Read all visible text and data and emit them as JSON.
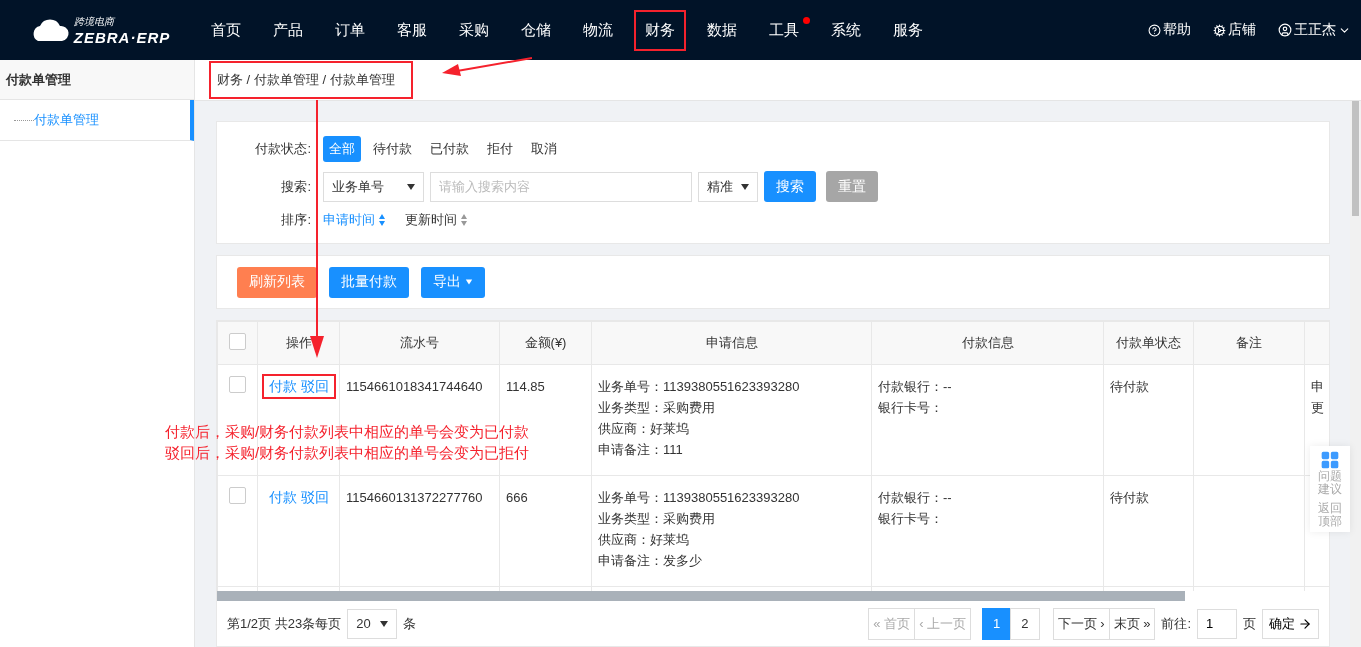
{
  "logo": {
    "tagline": "跨境电商",
    "name": "ZEBRA·ERP"
  },
  "nav": [
    {
      "label": "首页",
      "boxed": false,
      "dot": false
    },
    {
      "label": "产品",
      "boxed": false,
      "dot": false
    },
    {
      "label": "订单",
      "boxed": false,
      "dot": false
    },
    {
      "label": "客服",
      "boxed": false,
      "dot": false
    },
    {
      "label": "采购",
      "boxed": false,
      "dot": false
    },
    {
      "label": "仓储",
      "boxed": false,
      "dot": false
    },
    {
      "label": "物流",
      "boxed": false,
      "dot": false
    },
    {
      "label": "财务",
      "boxed": true,
      "dot": false
    },
    {
      "label": "数据",
      "boxed": false,
      "dot": false
    },
    {
      "label": "工具",
      "boxed": false,
      "dot": true
    },
    {
      "label": "系统",
      "boxed": false,
      "dot": false
    },
    {
      "label": "服务",
      "boxed": false,
      "dot": false
    }
  ],
  "user_menu": [
    {
      "kind": "help",
      "label": "帮助"
    },
    {
      "kind": "store",
      "label": "店铺"
    },
    {
      "kind": "user",
      "label": "王正杰"
    }
  ],
  "sidebar": {
    "title": "付款单管理",
    "items": [
      {
        "label": "付款单管理",
        "selected": true
      }
    ]
  },
  "breadcrumb": {
    "text": "财务 / 付款单管理 / 付款单管理",
    "boxed": true
  },
  "filters": {
    "status": {
      "label": "付款状态:",
      "options": [
        {
          "label": "全部",
          "selected": true
        },
        {
          "label": "待付款",
          "selected": false
        },
        {
          "label": "已付款",
          "selected": false
        },
        {
          "label": "拒付",
          "selected": false
        },
        {
          "label": "取消",
          "selected": false
        }
      ]
    },
    "search": {
      "label": "搜索:",
      "field_type": "业务单号",
      "placeholder": "请输入搜索内容",
      "match": "精准",
      "search_button": "搜索",
      "reset_button": "重置"
    },
    "sort": {
      "label": "排序:",
      "options": [
        {
          "label": "申请时间",
          "selected": true
        },
        {
          "label": "更新时间",
          "selected": false
        }
      ]
    }
  },
  "toolbar": [
    {
      "kind": "refresh",
      "label": "刷新列表"
    },
    {
      "kind": "primary",
      "label": "批量付款"
    },
    {
      "kind": "dropdown",
      "label": "导出"
    }
  ],
  "table": {
    "header_checked": false,
    "columns": [
      "操作",
      "流水号",
      "金额(¥)",
      "申请信息",
      "付款信息",
      "付款单状态",
      "备注"
    ],
    "rows": [
      {
        "checked": false,
        "actions_boxed": true,
        "actions": [
          "付款",
          "驳回"
        ],
        "serial": "1154661018341744640",
        "amount": "114.85",
        "apply_info": [
          "业务单号：1139380551623393280",
          "业务类型：采购费用",
          "供应商：好莱坞",
          "申请备注：111"
        ],
        "pay_info": [
          "付款银行：--",
          "银行卡号："
        ],
        "status": "待付款",
        "column_9": [
          "申",
          "更"
        ]
      },
      {
        "checked": false,
        "actions_boxed": false,
        "actions": [
          "付款",
          "驳回"
        ],
        "serial": "1154660131372277760",
        "amount": "666",
        "apply_info": [
          "业务单号：1139380551623393280",
          "业务类型：采购费用",
          "供应商：好莱坞",
          "申请备注：发多少"
        ],
        "pay_info": [
          "付款银行：--",
          "银行卡号："
        ],
        "status": "待付款"
      }
    ]
  },
  "annotation": [
    "付款后，采购/财务付款列表中相应的单号会变为已付款",
    "驳回后，采购/财务付款列表中相应的单号会变为已拒付"
  ],
  "pagination": {
    "summary": "第1/2页 共23条每页",
    "page_size": "20",
    "unit": "条",
    "nav_before": [
      {
        "label": "« 首页",
        "disabled": true
      },
      {
        "label": "‹ 上一页",
        "disabled": true
      }
    ],
    "pages": [
      {
        "label": "1",
        "selected": true
      },
      {
        "label": "2",
        "selected": false
      }
    ],
    "nav_after": [
      {
        "label": "下一页 ›",
        "disabled": false
      },
      {
        "label": "末页 »",
        "disabled": false
      }
    ],
    "goto_label": "前往:",
    "goto_value": "1",
    "page_unit": "页",
    "confirm": "确定"
  },
  "float_widget": [
    {
      "kind": "feedback",
      "label": "问题建议"
    },
    {
      "kind": "top",
      "label": "返回顶部"
    }
  ]
}
